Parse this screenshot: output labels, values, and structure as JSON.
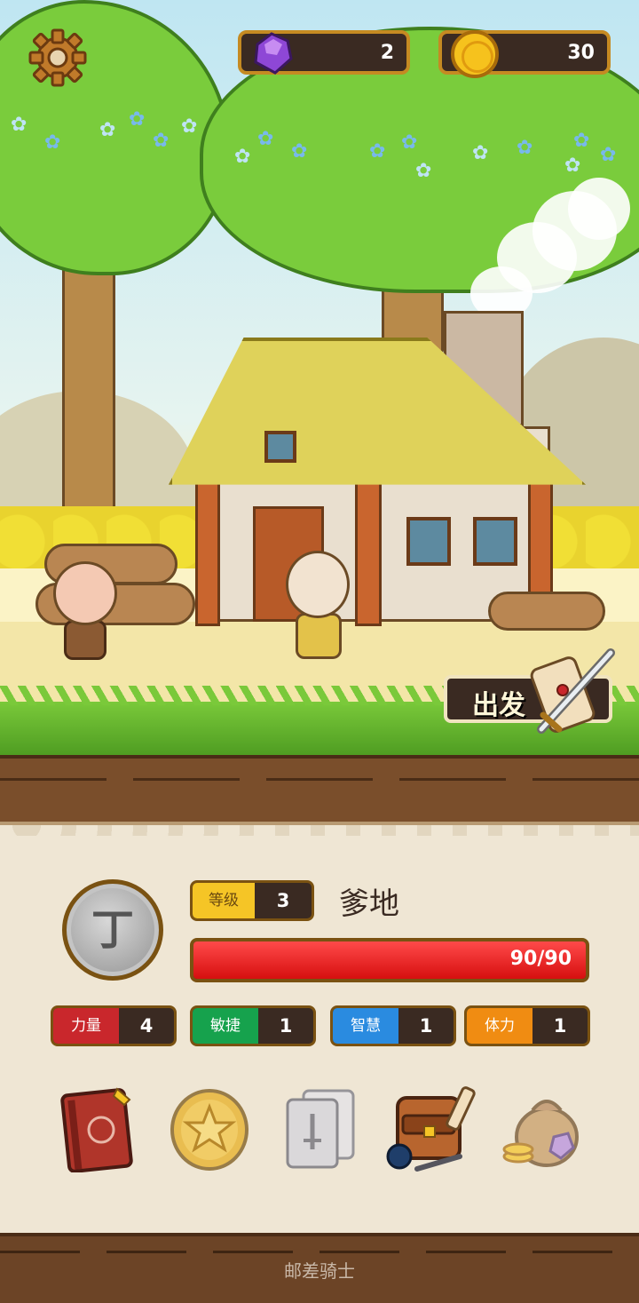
{
  "hud": {
    "gems": "2",
    "coins": "30",
    "settings_icon": "gear-icon",
    "gem_icon": "gem-icon",
    "coin_icon": "coin-icon"
  },
  "scene": {
    "depart_label": "出发",
    "depart_icon": "sword-scroll-icon"
  },
  "character": {
    "medal_letter": "丁",
    "level_label": "等级",
    "level": "3",
    "name": "爹地",
    "hp_text": "90/90",
    "hp_fraction": 1.0,
    "hp_color": "#e81818"
  },
  "stats": [
    {
      "label": "力量",
      "value": "4",
      "color": "#c9272c"
    },
    {
      "label": "敏捷",
      "value": "1",
      "color": "#16a24d"
    },
    {
      "label": "智慧",
      "value": "1",
      "color": "#2a8be0"
    },
    {
      "label": "体力",
      "value": "1",
      "color": "#f08c12"
    }
  ],
  "menu": [
    {
      "icon": "journal-book-icon"
    },
    {
      "icon": "star-coin-icon"
    },
    {
      "icon": "card-deck-icon"
    },
    {
      "icon": "inventory-backpack-icon"
    },
    {
      "icon": "treasure-bag-icon"
    }
  ],
  "app_title": "邮差骑士"
}
